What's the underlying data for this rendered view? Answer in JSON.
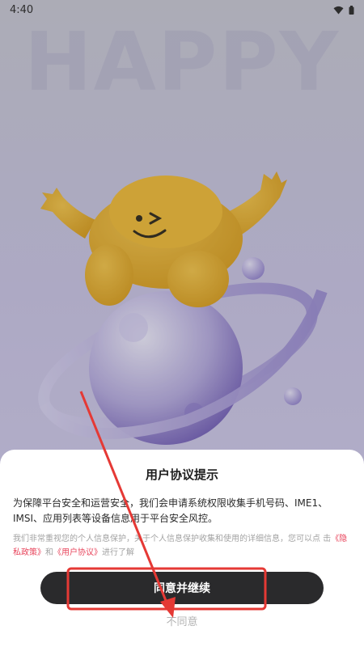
{
  "status_bar": {
    "time": "4:40",
    "icons": [
      "wifi-icon",
      "battery-icon"
    ]
  },
  "background": {
    "watermark_text": "HAPPY"
  },
  "dialog": {
    "title": "用户协议提示",
    "body": "为保障平台安全和运营安全，我们会申请系统权限收集手机号码、IME1、IMSI、应用列表等设备信息用于平台安全风控。",
    "note_prefix": "我们非常重视您的个人信息保护，关于个人信息保护收集和使用的详细信息，您可以点 击",
    "privacy_link": "《隐私政策》",
    "note_and": "和",
    "user_agreement_link": "《用户协议》",
    "note_suffix": "进行了解",
    "agree_label": "同意并继续",
    "disagree_label": "不同意"
  },
  "colors": {
    "accent_link": "#e8455c",
    "button_bg": "#2a2a2c",
    "annotation": "#e53935"
  }
}
